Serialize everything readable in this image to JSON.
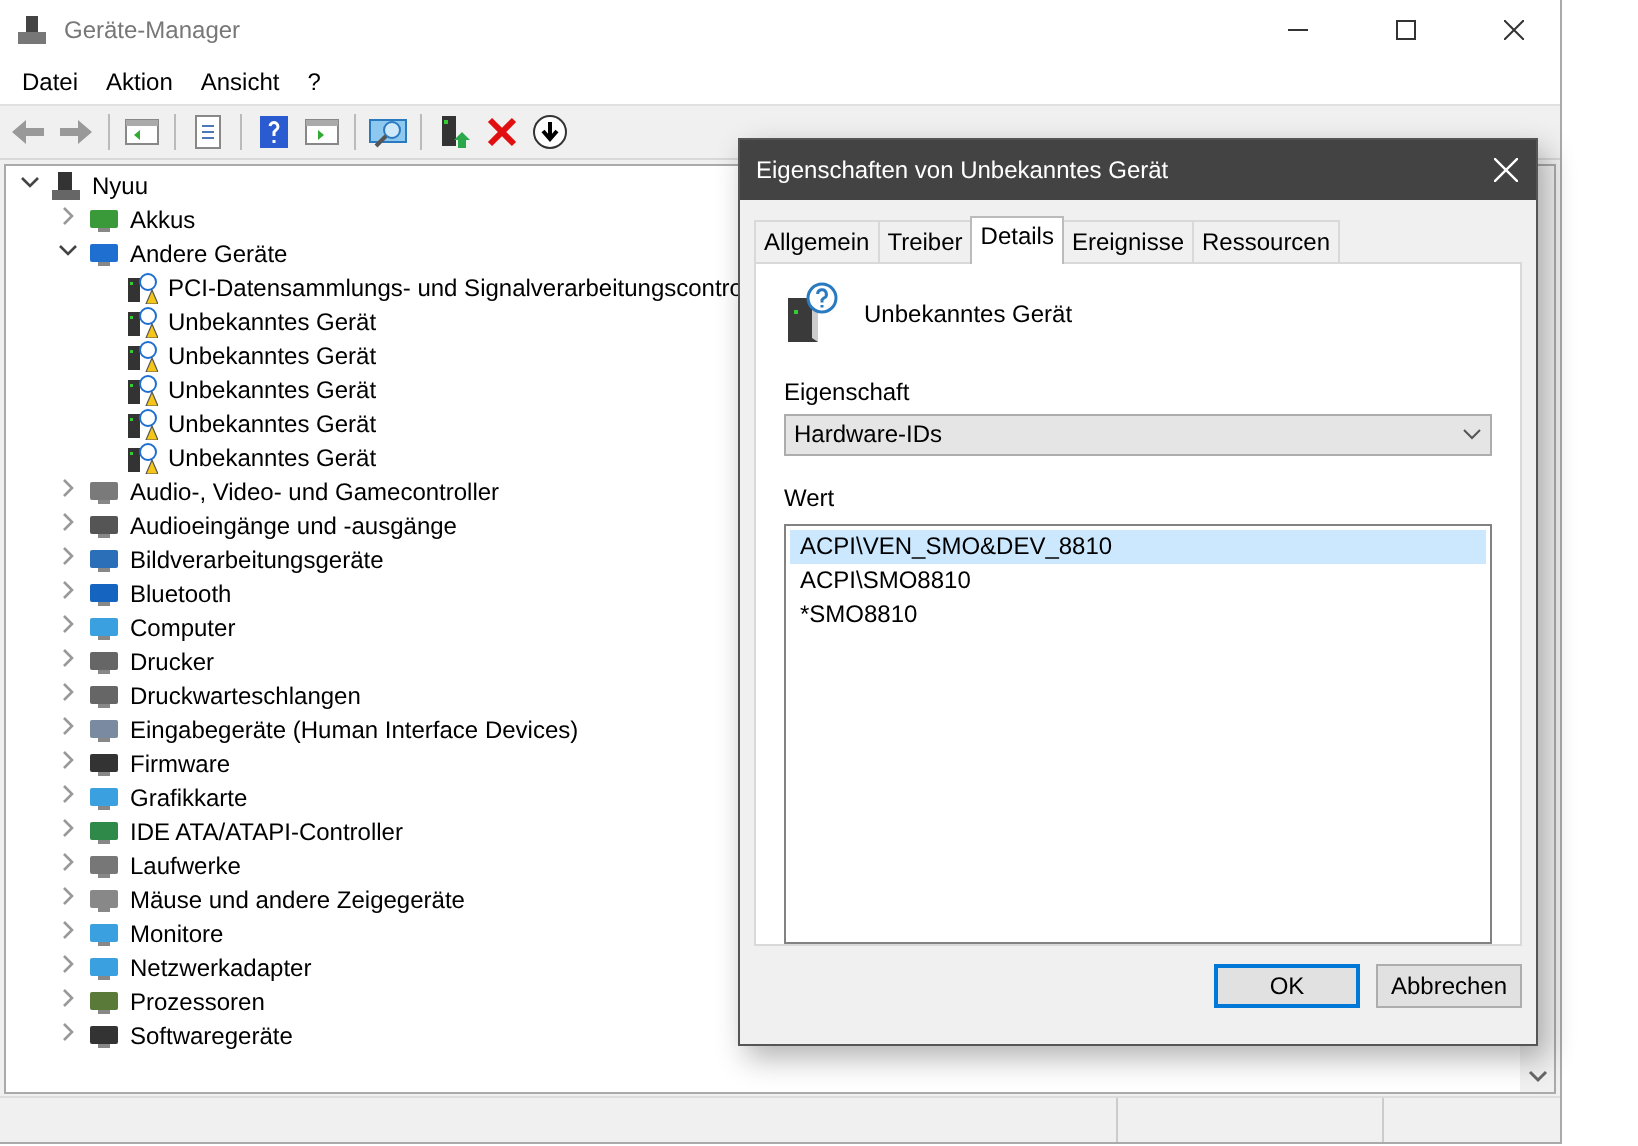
{
  "window": {
    "title": "Geräte-Manager"
  },
  "menu": [
    "Datei",
    "Aktion",
    "Ansicht",
    "?"
  ],
  "tree": {
    "label": "Nyuu",
    "expanded": true,
    "children": [
      {
        "label": "Akkus",
        "expanded": false
      },
      {
        "label": "Andere Geräte",
        "expanded": true,
        "children": [
          {
            "label": "PCI-Datensammlungs- und Signalverarbeitungscontro",
            "problem": true
          },
          {
            "label": "Unbekanntes Gerät",
            "problem": true
          },
          {
            "label": "Unbekanntes Gerät",
            "problem": true
          },
          {
            "label": "Unbekanntes Gerät",
            "problem": true
          },
          {
            "label": "Unbekanntes Gerät",
            "problem": true
          },
          {
            "label": "Unbekanntes Gerät",
            "problem": true
          }
        ]
      },
      {
        "label": "Audio-, Video- und Gamecontroller",
        "expanded": false
      },
      {
        "label": "Audioeingänge und -ausgänge",
        "expanded": false
      },
      {
        "label": "Bildverarbeitungsgeräte",
        "expanded": false
      },
      {
        "label": "Bluetooth",
        "expanded": false
      },
      {
        "label": "Computer",
        "expanded": false
      },
      {
        "label": "Drucker",
        "expanded": false
      },
      {
        "label": "Druckwarteschlangen",
        "expanded": false
      },
      {
        "label": "Eingabegeräte (Human Interface Devices)",
        "expanded": false
      },
      {
        "label": "Firmware",
        "expanded": false
      },
      {
        "label": "Grafikkarte",
        "expanded": false
      },
      {
        "label": "IDE ATA/ATAPI-Controller",
        "expanded": false
      },
      {
        "label": "Laufwerke",
        "expanded": false
      },
      {
        "label": "Mäuse und andere Zeigegeräte",
        "expanded": false
      },
      {
        "label": "Monitore",
        "expanded": false
      },
      {
        "label": "Netzwerkadapter",
        "expanded": false
      },
      {
        "label": "Prozessoren",
        "expanded": false
      },
      {
        "label": "Softwaregeräte",
        "expanded": false
      }
    ]
  },
  "dialog": {
    "title": "Eigenschaften von Unbekanntes Gerät",
    "tabs": [
      {
        "label": "Allgemein",
        "selected": false
      },
      {
        "label": "Treiber",
        "selected": false
      },
      {
        "label": "Details",
        "selected": true
      },
      {
        "label": "Ereignisse",
        "selected": false
      },
      {
        "label": "Ressourcen",
        "selected": false
      }
    ],
    "device_name": "Unbekanntes Gerät",
    "property_label": "Eigenschaft",
    "property_value": "Hardware-IDs",
    "value_label": "Wert",
    "values": [
      {
        "text": "ACPI\\VEN_SMO&DEV_8810",
        "selected": true
      },
      {
        "text": "ACPI\\SMO8810",
        "selected": false
      },
      {
        "text": "*SMO8810",
        "selected": false
      }
    ],
    "buttons": [
      {
        "label": "OK",
        "default": true
      },
      {
        "label": "Abbrechen",
        "default": false
      }
    ]
  }
}
